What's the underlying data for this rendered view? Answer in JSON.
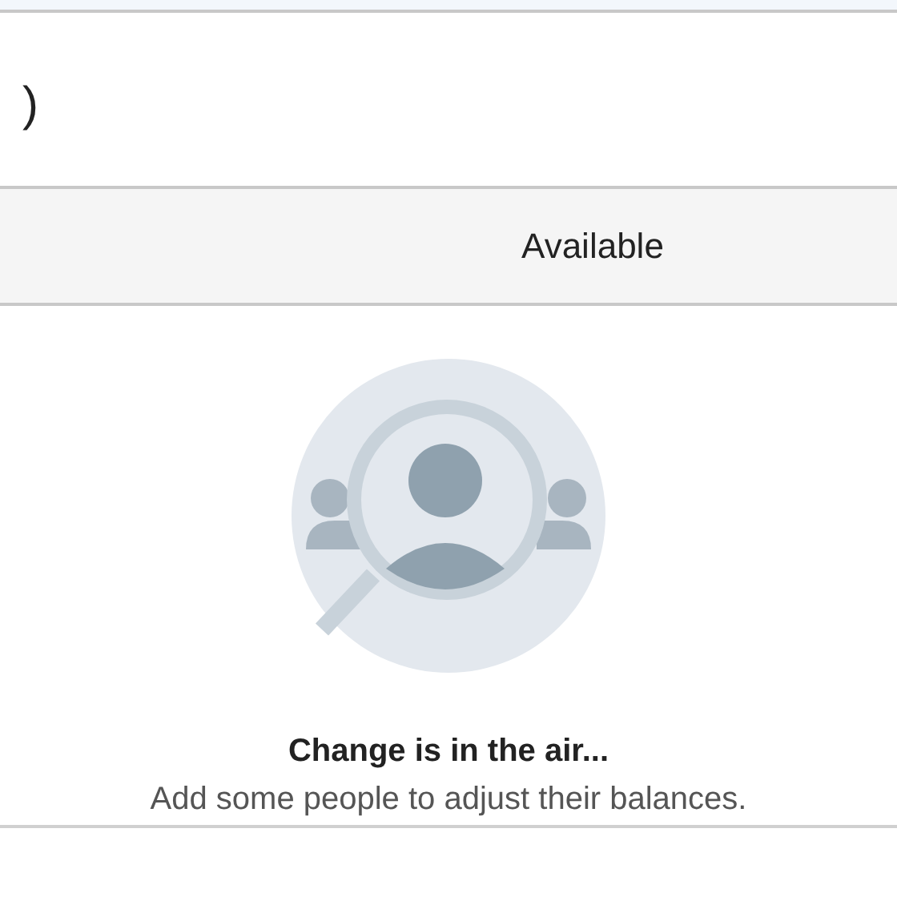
{
  "heading": {
    "text": ")"
  },
  "table": {
    "columns": [
      {
        "label": "Available"
      }
    ]
  },
  "empty_state": {
    "title": "Change is in the air...",
    "message": "Add some people to adjust their balances."
  }
}
